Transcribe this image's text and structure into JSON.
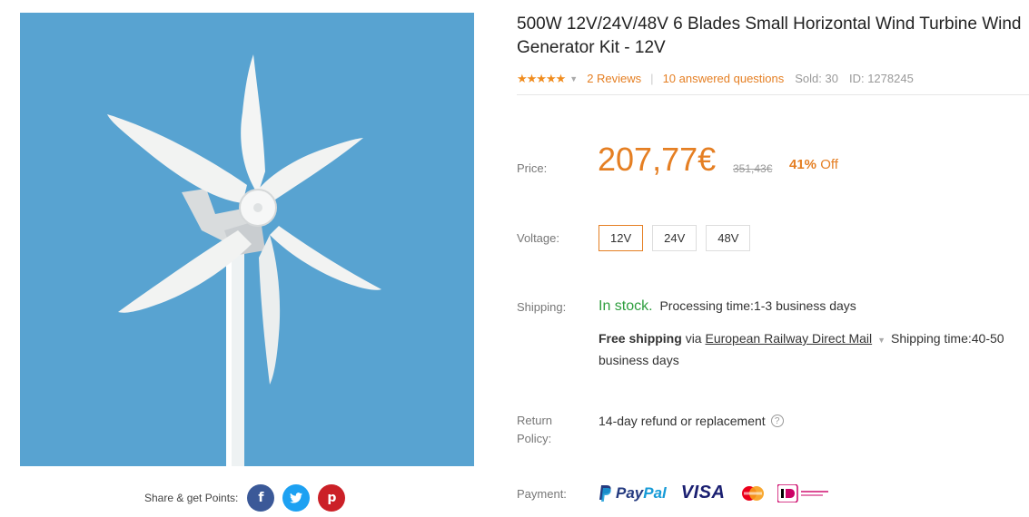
{
  "product": {
    "title": "500W 12V/24V/48V 6 Blades Small Horizontal Wind Turbine Wind Generator Kit - 12V",
    "rating": 5,
    "stars": "★★★★★",
    "reviews_label": "2 Reviews",
    "questions_label": "10 answered questions",
    "sold_label": "Sold: 30",
    "id_label": "ID: 1278245"
  },
  "price": {
    "label": "Price:",
    "current": "207,77€",
    "original": "351,43€",
    "discount_percent": "41%",
    "discount_word": "Off"
  },
  "voltage": {
    "label": "Voltage:",
    "options": [
      "12V",
      "24V",
      "48V"
    ],
    "selected": "12V"
  },
  "shipping": {
    "label": "Shipping:",
    "stock_status": "In stock.",
    "processing": "Processing time:1-3 business days",
    "free_label": "Free shipping",
    "via": "via",
    "carrier": "European Railway Direct Mail",
    "time": "Shipping time:40-50 business days"
  },
  "return_policy": {
    "label_line1": "Return",
    "label_line2": "Policy:",
    "text": "14-day refund or replacement"
  },
  "payment": {
    "label": "Payment:",
    "methods": [
      "PayPal",
      "VISA",
      "MasterCard",
      "iDEAL"
    ],
    "paypal_part1": "Pay",
    "paypal_part2": "Pal",
    "visa": "VISA"
  },
  "share": {
    "label": "Share & get Points:",
    "networks": [
      "facebook",
      "twitter",
      "pinterest"
    ]
  },
  "colors": {
    "accent": "#e57f23",
    "in_stock": "#2e9e3e",
    "image_bg": "#58a3d1"
  }
}
